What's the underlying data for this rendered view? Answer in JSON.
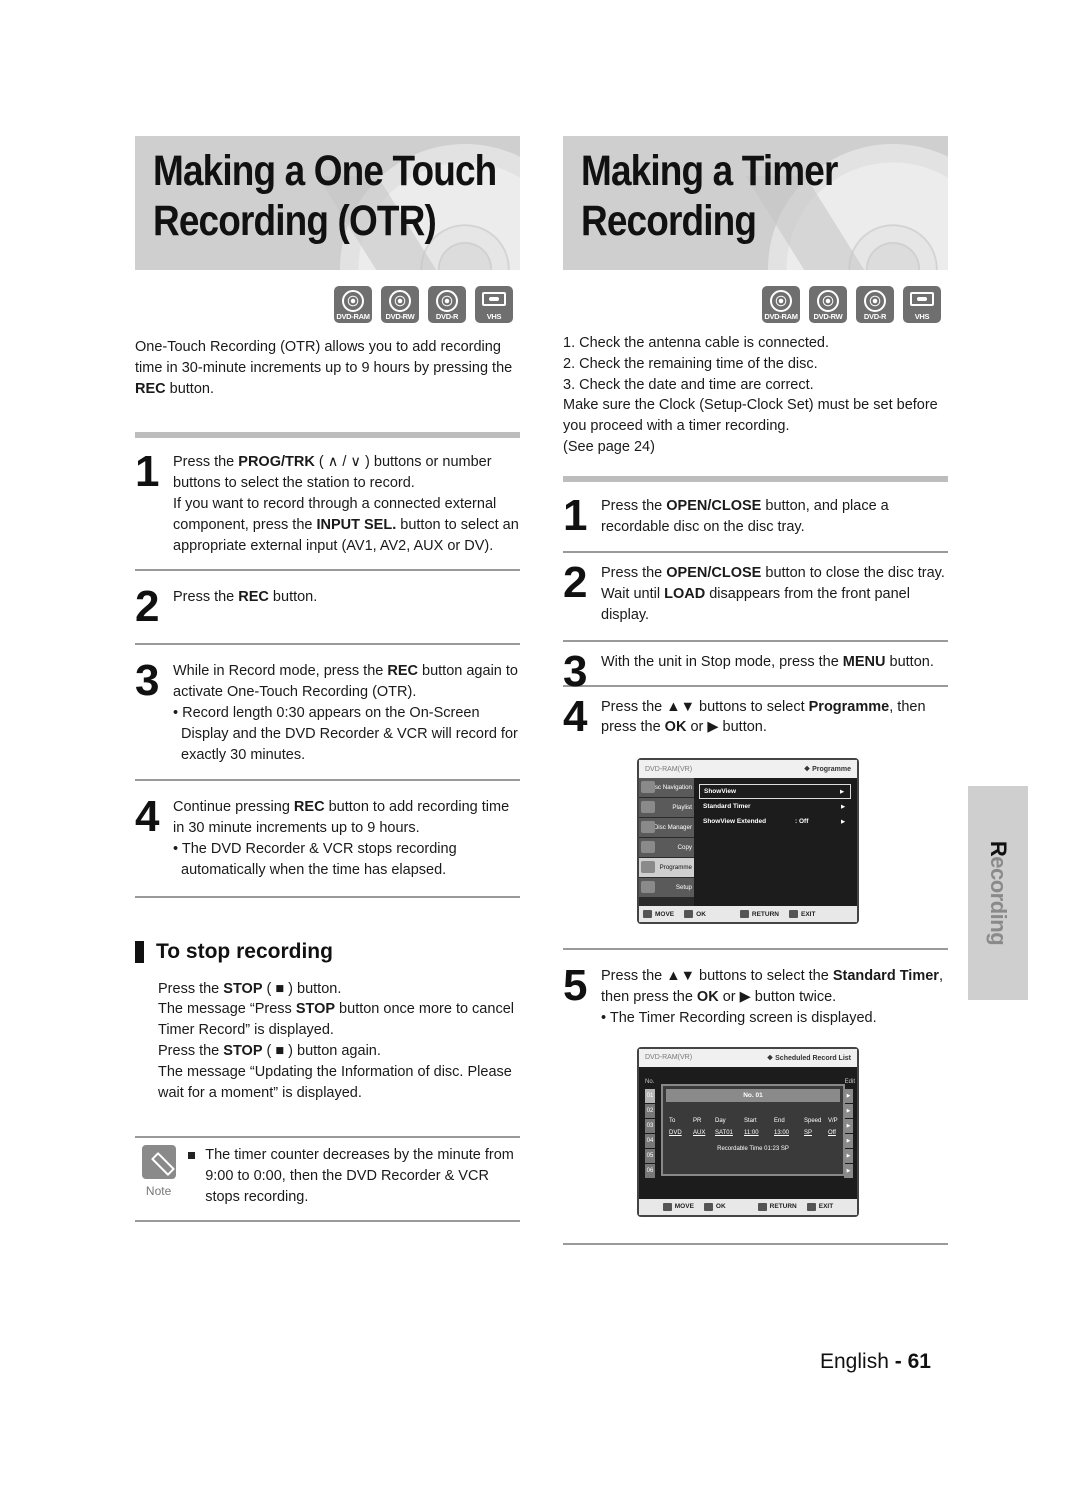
{
  "left_section": {
    "title_line1": "Making a One Touch",
    "title_line2": "Recording (OTR)",
    "badges": [
      {
        "icon": "dvd-disc-icon",
        "label": "DVD-RAM"
      },
      {
        "icon": "dvd-disc-icon",
        "label": "DVD-RW"
      },
      {
        "icon": "dvd-disc-icon",
        "label": "DVD-R"
      },
      {
        "icon": "vhs-cassette-icon",
        "label": "VHS"
      }
    ],
    "intro": {
      "pre": "One-Touch Recording (OTR) allows you to add recording time in 30-minute increments up to 9 hours by pressing the ",
      "bold": "REC",
      "post": " button."
    },
    "steps": [
      {
        "number": "1",
        "t1": "Press the ",
        "b1": "PROG/TRK",
        "t2": " ( ∧ / ∨ ) buttons or number buttons to select the station to record.",
        "t3": "If you want to record through a connected external component, press the ",
        "b2": "INPUT SEL.",
        "t4": " button to select an appropriate external input (AV1, AV2, AUX or DV)."
      },
      {
        "number": "2",
        "t1": "Press the ",
        "b1": "REC",
        "t2": " button."
      },
      {
        "number": "3",
        "t1": "While in Record mode, press the ",
        "b1": "REC",
        "t2": " button again to activate One-Touch Recording (OTR).",
        "bullet": "• Record length 0:30 appears on the On-Screen Display and the DVD Recorder & VCR will record for exactly 30 minutes."
      },
      {
        "number": "4",
        "t1": "Continue pressing ",
        "b1": "REC",
        "t2": " button to add recording time in 30 minute increments up to 9 hours.",
        "bullet": "• The DVD Recorder & VCR stops recording automatically when the time has elapsed."
      }
    ],
    "stop_section": {
      "heading": "To stop recording",
      "l1_pre": "Press the ",
      "l1_bold": "STOP",
      "l1_post": " ( ■ ) button.",
      "l2_pre": "The message “Press ",
      "l2_bold": "STOP",
      "l2_post": " button once more to cancel Timer Record” is displayed.",
      "l3_pre": "Press the ",
      "l3_bold": "STOP",
      "l3_post": " ( ■ ) button again.",
      "l4": "The message “Updating the Information of disc. Please wait for a moment” is displayed."
    },
    "note": {
      "label": "Note",
      "text": "The timer counter decreases by the minute from 9:00 to 0:00, then the DVD Recorder & VCR stops recording."
    }
  },
  "right_section": {
    "title_line1": "Making a Timer",
    "title_line2": "Recording",
    "badges": [
      {
        "icon": "dvd-disc-icon",
        "label": "DVD-RAM"
      },
      {
        "icon": "dvd-disc-icon",
        "label": "DVD-RW"
      },
      {
        "icon": "dvd-disc-icon",
        "label": "DVD-R"
      },
      {
        "icon": "vhs-cassette-icon",
        "label": "VHS"
      }
    ],
    "checklist": [
      "1. Check the antenna cable is connected.",
      "2. Check the remaining time of the disc.",
      "3. Check the date and time are correct.",
      "Make sure the Clock (Setup-Clock Set) must be set before you proceed with a timer recording.",
      "(See page 24)"
    ],
    "steps": [
      {
        "number": "1",
        "t1": "Press the ",
        "b1": "OPEN/CLOSE",
        "t2": " button, and place a recordable disc on the disc tray."
      },
      {
        "number": "2",
        "t1": "Press the ",
        "b1": "OPEN/CLOSE",
        "t2": " button to close the disc tray.",
        "t3": "Wait until ",
        "b2": "LOAD",
        "t4": " disappears from the front panel display."
      },
      {
        "number": "3",
        "t1": "With the unit in Stop mode, press the ",
        "b1": "MENU",
        "t2": " button."
      },
      {
        "number": "4",
        "t1": "Press the ▲▼ buttons to select ",
        "b1": "Programme",
        "t2": ", then press the ",
        "b2": "OK",
        "t3": " or ▶ button."
      },
      {
        "number": "5",
        "t1": "Press the ▲▼ buttons to select the ",
        "b1": "Standard Timer",
        "t2": ", then press the ",
        "b2": "OK",
        "t3": " or ▶ button twice.",
        "bullet": "• The Timer Recording screen is displayed."
      }
    ],
    "programme_menu": {
      "header_left": "DVD-RAM(VR)",
      "header_right": "❖ Programme",
      "sidebar": [
        "Disc Navigation",
        "Playlist",
        "Disc Manager",
        "Copy",
        "Programme",
        "Setup"
      ],
      "active_sidebar": "Programme",
      "options": [
        {
          "label": "ShowView",
          "value": "",
          "selected": true
        },
        {
          "label": "Standard Timer",
          "value": "",
          "selected": false
        },
        {
          "label": "ShowView Extended",
          "value": ": Off",
          "selected": false
        }
      ],
      "footer": {
        "move": "MOVE",
        "ok": "OK",
        "return": "RETURN",
        "exit": "EXIT"
      }
    },
    "schedule_screen": {
      "header_left": "DVD-RAM(VR)",
      "header_right": "❖  Scheduled Record List",
      "list_header": "No.",
      "edit_header": "Edit",
      "numbers": [
        "01",
        "02",
        "03",
        "04",
        "05",
        "06"
      ],
      "dialog_title": "No. 01",
      "columns": [
        "To",
        "PR",
        "Day",
        "Start",
        "End",
        "Speed",
        "V/P"
      ],
      "values": [
        "DVD",
        "AUX",
        "SAT01",
        "11:00",
        "13:00",
        "SP",
        "Off"
      ],
      "recordable_time": "Recordable Time 01:23 SP",
      "footer": {
        "move": "MOVE",
        "ok": "OK",
        "return": "RETURN",
        "exit": "EXIT"
      }
    }
  },
  "side_tab": {
    "label": "Recording"
  },
  "footer": {
    "language": "English",
    "separator": " - ",
    "page_number": "61"
  }
}
